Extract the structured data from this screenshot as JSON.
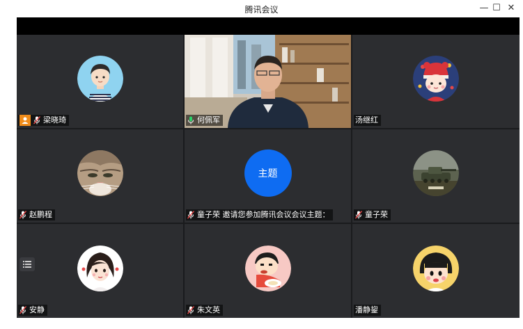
{
  "window": {
    "title": "腾讯会议",
    "minimize": "—",
    "maximize": "☐",
    "close": "✕"
  },
  "participants": [
    {
      "name": "梁晓琦",
      "avatar": "boy-cartoon-icon",
      "host": true
    },
    {
      "name": "何佩军",
      "avatar": "live-video",
      "speaking": true
    },
    {
      "name": "汤继红",
      "avatar": "girl-red-hat-icon"
    },
    {
      "name": "赵鹏程",
      "avatar": "cat-icon"
    },
    {
      "name": "童子荣 邀请您参加腾讯会议会议主题：",
      "avatar": "theme",
      "theme_text": "主题"
    },
    {
      "name": "童子荣",
      "avatar": "tank-icon"
    },
    {
      "name": "安静",
      "avatar": "girl-sketch-icon"
    },
    {
      "name": "朱文英",
      "avatar": "crayon-boy-icon"
    },
    {
      "name": "潘静鋆",
      "avatar": "maruko-icon"
    }
  ],
  "colors": {
    "tile_bg": "#2c2d30",
    "theme_blue": "#0e6cf2",
    "host_orange": "#f08c1a",
    "speaking_green": "#2bd46a"
  }
}
